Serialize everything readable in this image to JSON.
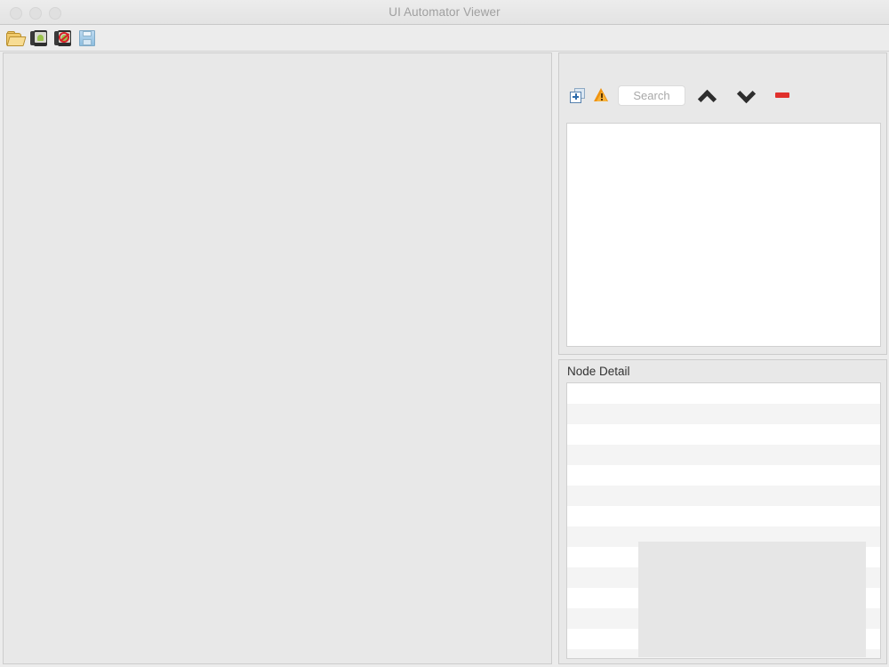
{
  "window": {
    "title": "UI Automator Viewer",
    "traffic_lights": [
      "close",
      "minimize",
      "zoom"
    ]
  },
  "toolbar": {
    "buttons": [
      {
        "name": "open-file-button",
        "icon": "folder-open-icon",
        "label": "Open"
      },
      {
        "name": "device-screenshot-button",
        "icon": "device-screenshot-icon",
        "label": "Device Screenshot (uiautomator dump)"
      },
      {
        "name": "device-screenshot-compressed-button",
        "icon": "device-screenshot-nocompress-icon",
        "label": "Device Screenshot with Compressed Hierarchy"
      },
      {
        "name": "save-button",
        "icon": "save-floppy-icon",
        "label": "Save"
      }
    ]
  },
  "left_panel": {
    "name": "screenshot-viewport",
    "content": ""
  },
  "tree_pane": {
    "toolbar": {
      "expand_all_label": "Toggle NAF Nodes",
      "warning_label": "Show NAF Nodes",
      "search": {
        "placeholder": "Search",
        "value": ""
      },
      "prev_label": "Previous match",
      "next_label": "Next match",
      "clear_label": "Clear search"
    },
    "tree_items": []
  },
  "node_detail": {
    "title": "Node Detail",
    "rows": [
      {
        "key": "",
        "value": ""
      },
      {
        "key": "",
        "value": ""
      },
      {
        "key": "",
        "value": ""
      },
      {
        "key": "",
        "value": ""
      },
      {
        "key": "",
        "value": ""
      },
      {
        "key": "",
        "value": ""
      },
      {
        "key": "",
        "value": ""
      },
      {
        "key": "",
        "value": ""
      },
      {
        "key": "",
        "value": ""
      },
      {
        "key": "",
        "value": ""
      },
      {
        "key": "",
        "value": ""
      },
      {
        "key": "",
        "value": ""
      },
      {
        "key": "",
        "value": ""
      },
      {
        "key": "",
        "value": ""
      }
    ]
  },
  "colors": {
    "window_chrome": "#ececec",
    "panel_background": "#e8e8e8",
    "panel_border": "#cccccc",
    "title_text": "#a0a0a0",
    "row_odd": "#ffffff",
    "row_even": "#f4f4f4",
    "overlay_gray": "#e6e6e6",
    "accent_red": "#e0302c",
    "accent_blue": "#2f6caa",
    "accent_orange": "#f0930f",
    "android_green": "#9bc34a"
  }
}
